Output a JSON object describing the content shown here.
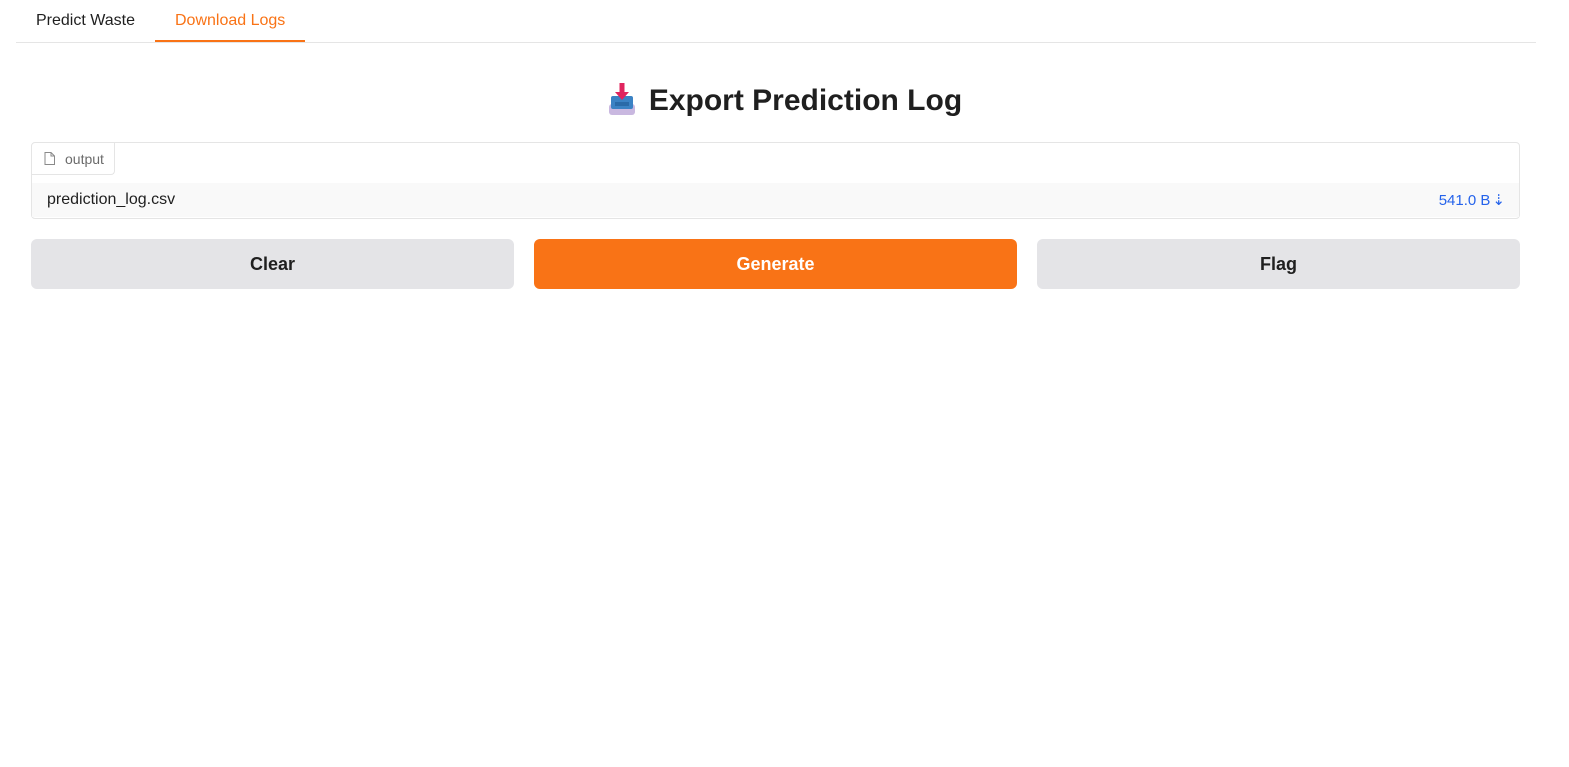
{
  "tabs": [
    {
      "label": "Predict Waste",
      "active": false
    },
    {
      "label": "Download Logs",
      "active": true
    }
  ],
  "heading": {
    "icon": "inbox-tray-icon",
    "text": "Export Prediction Log"
  },
  "file_output": {
    "label": "output",
    "label_icon": "file-icon",
    "file_name": "prediction_log.csv",
    "file_size": "541.0 B",
    "download_glyph": "⇣"
  },
  "buttons": {
    "clear": "Clear",
    "generate": "Generate",
    "flag": "Flag"
  },
  "colors": {
    "accent": "#f97316",
    "link": "#2563eb",
    "secondary_button": "#e4e4e7"
  }
}
